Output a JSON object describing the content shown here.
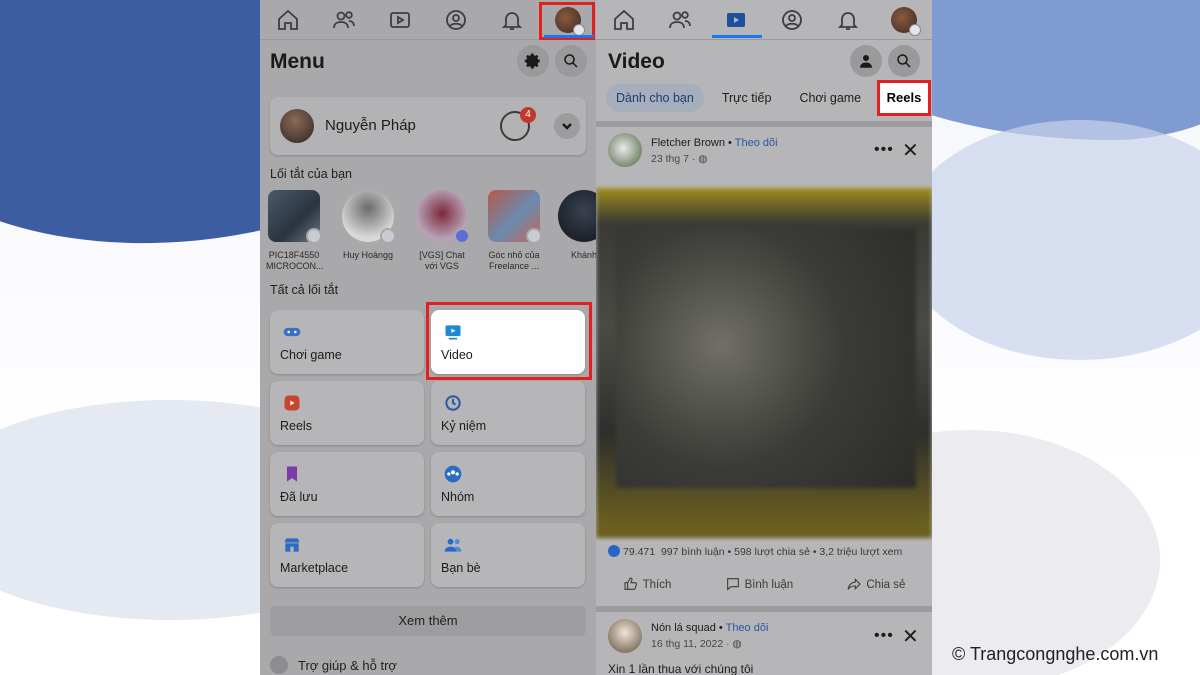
{
  "left_screen": {
    "menu_title": "Menu",
    "profile": {
      "name": "Nguyễn Pháp",
      "story_badge": "4"
    },
    "shortcuts_label": "Lối tắt của bạn",
    "shortcuts": [
      {
        "label": "PIC18F4550 MICROCON..."
      },
      {
        "label": "Huy Hoàngg"
      },
      {
        "label": "[VGS] Chat với VGS"
      },
      {
        "label": "Góc nhỏ của Freelance ..."
      },
      {
        "label": "Khánh"
      }
    ],
    "all_shortcuts_label": "Tất cả lối tắt",
    "tiles": [
      {
        "label": "Chơi game",
        "icon": "gamepad-icon"
      },
      {
        "label": "Video",
        "icon": "video-icon"
      },
      {
        "label": "Reels",
        "icon": "reels-icon"
      },
      {
        "label": "Kỷ niệm",
        "icon": "memories-icon"
      },
      {
        "label": "Đã lưu",
        "icon": "bookmark-icon"
      },
      {
        "label": "Nhóm",
        "icon": "groups-icon"
      },
      {
        "label": "Marketplace",
        "icon": "store-icon"
      },
      {
        "label": "Bạn bè",
        "icon": "friends-icon"
      }
    ],
    "see_more": "Xem thêm",
    "help": "Trợ giúp & hỗ trợ"
  },
  "right_screen": {
    "title": "Video",
    "chips": [
      "Dành cho bạn",
      "Trực tiếp",
      "Chơi game",
      "Reels"
    ],
    "post1": {
      "author": "Fletcher Brown",
      "follow": "Theo dõi",
      "date": "23 thg 7",
      "likes": "79.471",
      "stats": "997 bình luận • 598 lượt chia sẻ • 3,2 triệu lượt xem"
    },
    "actions": [
      "Thích",
      "Bình luận",
      "Chia sẻ"
    ],
    "post2": {
      "author": "Nón lá squad",
      "follow": "Theo dõi",
      "date": "16 thg 11, 2022",
      "caption": "Xin 1 lần thua với chúng tôi"
    }
  },
  "watermark": "© Trangcongnghe.com.vn",
  "colors": {
    "highlight": "#e0211f",
    "accent": "#1877f2"
  }
}
